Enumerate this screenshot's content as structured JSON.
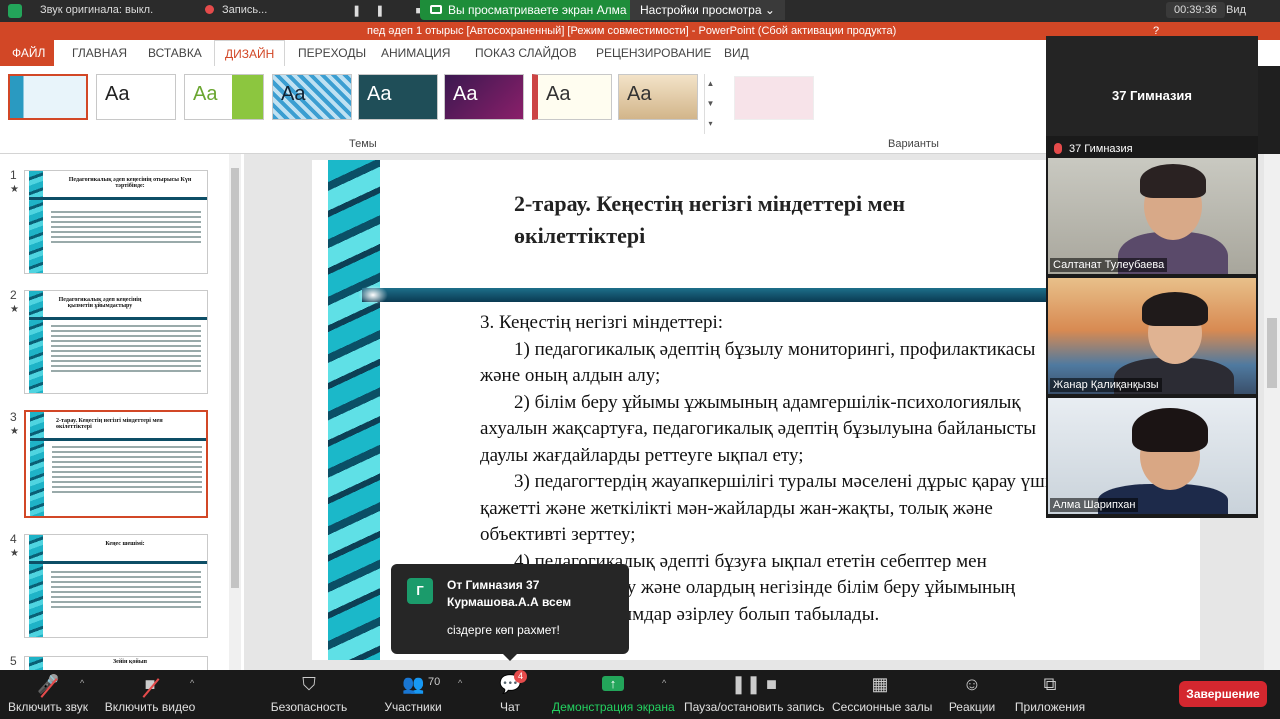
{
  "zoom_top": {
    "audio_label": "Звук оригинала: выкл.",
    "record_label": "Запись...",
    "share_banner": "Вы просматриваете экран Алма Шарипхан",
    "view_options": "Настройки просмотра",
    "timer": "00:39:36",
    "view_label": "Вид"
  },
  "ppt": {
    "title": "пед әдеп 1 отырыс [Автосохраненный] [Режим совместимости] - PowerPoint (Сбой активации продукта)",
    "help": "?",
    "tabs": [
      "ФАЙЛ",
      "ГЛАВНАЯ",
      "ВСТАВКА",
      "ДИЗАЙН",
      "ПЕРЕХОДЫ",
      "АНИМАЦИЯ",
      "ПОКАЗ СЛАЙДОВ",
      "РЕЦЕНЗИРОВАНИЕ",
      "ВИД"
    ],
    "themes_label": "Темы",
    "variants_label": "Варианты",
    "theme_sample": "Aa",
    "scroll_up": "▲",
    "scroll_down": "▼",
    "scroll_more": "▾"
  },
  "thumbnails": [
    {
      "num": "1",
      "star": "★",
      "title": "Педагогикалық әдеп кеңесінің отырысы Күн тәртібінде:"
    },
    {
      "num": "2",
      "star": "★",
      "title": "Педагогикалық әдеп кеңесінің қызметін ұйымдастыру"
    },
    {
      "num": "3",
      "star": "★",
      "title": "2-тарау. Кеңестің негізгі міндеттері мен өкілеттіктері"
    },
    {
      "num": "4",
      "star": "★",
      "title": "Кеңес шешімі:"
    },
    {
      "num": "5",
      "star": "",
      "title": "Зейін қойып"
    }
  ],
  "slide": {
    "title": "2-тарау. Кеңестің негізгі міндеттері мен өкілеттіктері",
    "lines": [
      "3. Кеңестің негізгі міндеттері:",
      "1) педагогикалық әдептің бұзылу мониторингі, профилактикасы және оның алдын алу;",
      "2) білім беру ұйымы ұжымының адамгершілік-психологиялық ахуалын жақсартуға, педагогикалық әдептің бұзылуына байланысты даулы жағдайларды реттеуге ықпал ету;",
      "3) педагогтердің жауапкершілігі туралы мәселені дұрыс қарау үшін қажетті және жеткілікті мән-жайларды жан-жақты, толық және объективті зерттеу;",
      "4) педагогикалық әдепті бұзуға ықпал ететін себептер мен жағдайларды қарау және олардың негізінде білім беру ұйымының басшысына ұсынымдар әзірлеу болып табылады."
    ]
  },
  "participants": {
    "host": "37 Гимназия",
    "tiles": [
      {
        "name": "37 Гимназия"
      },
      {
        "name": "Салтанат Тулеубаева"
      },
      {
        "name": "Жанар Қалиқанқызы"
      },
      {
        "name": "Алма Шарипхан"
      }
    ]
  },
  "chat": {
    "avatar": "Г",
    "from": "От Гимназия 37 Курмашова.А.А всем",
    "message": "сіздерге көп рахмет!"
  },
  "toolbar": {
    "mute": "Включить звук",
    "video": "Включить видео",
    "security": "Безопасность",
    "participants": "Участники",
    "participants_count": "70",
    "chat": "Чат",
    "chat_badge": "4",
    "share": "Демонстрация экрана",
    "pause": "Пауза/остановить запись",
    "breakout": "Сессионные залы",
    "reactions": "Реакции",
    "apps": "Приложения",
    "end": "Завершение"
  }
}
